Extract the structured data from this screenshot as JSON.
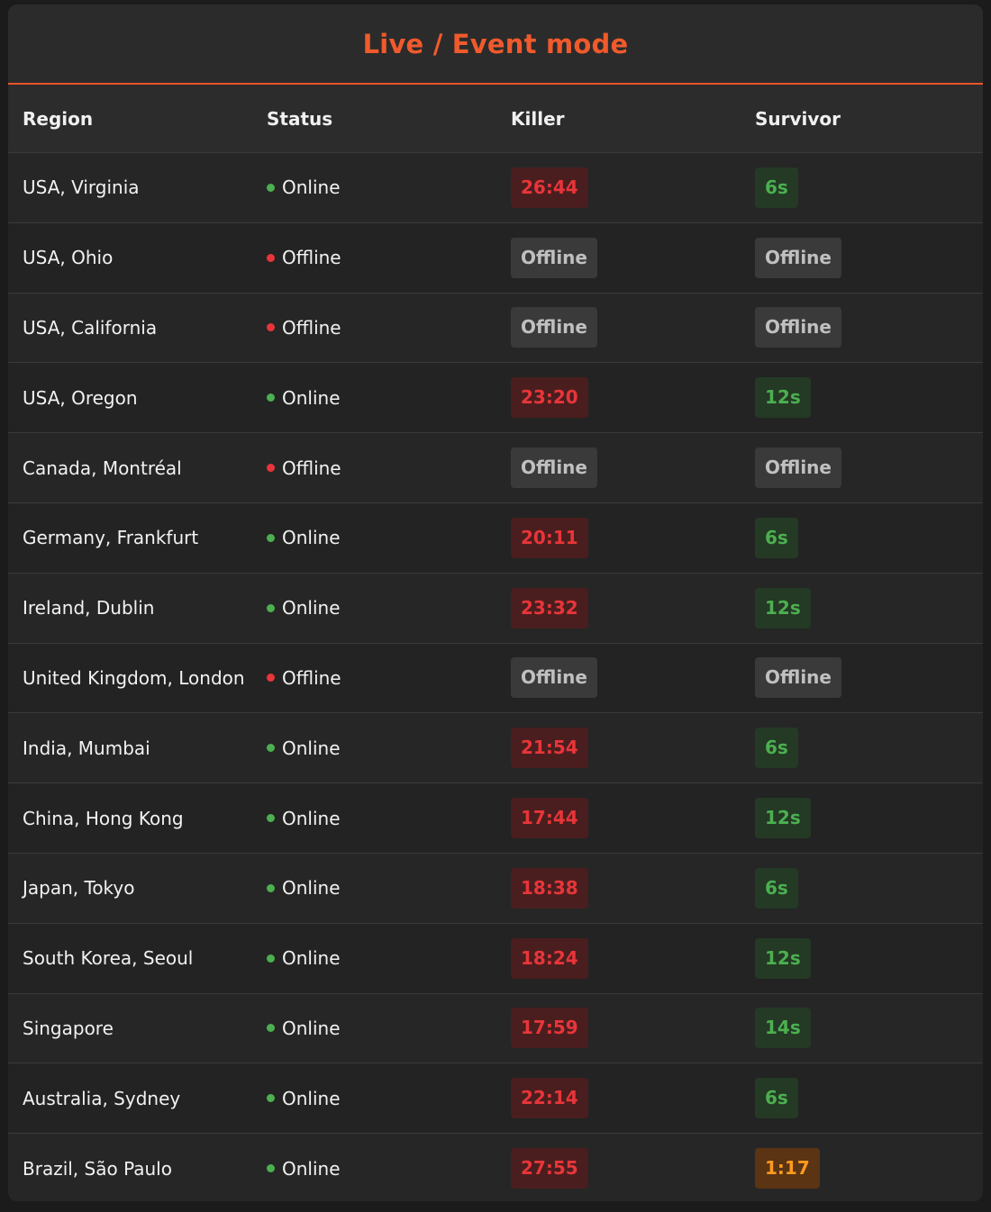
{
  "title": "Live / Event mode",
  "headers": {
    "region": "Region",
    "status": "Status",
    "killer": "Killer",
    "survivor": "Survivor"
  },
  "colors": {
    "accent": "#f05a2c",
    "online": "#4caf50",
    "offline": "#e8353a",
    "killer": "#e8353a",
    "survivor": "#4caf50",
    "survivor_slow": "#ff9a1f",
    "offline_badge": "#c0c0c0"
  },
  "rows": [
    {
      "region": "USA, Virginia",
      "status": "Online",
      "status_color": "#4caf50",
      "killer": "26:44",
      "killer_style": "red",
      "survivor": "6s",
      "survivor_style": "green"
    },
    {
      "region": "USA, Ohio",
      "status": "Offline",
      "status_color": "#e8353a",
      "killer": "Offline",
      "killer_style": "gray",
      "survivor": "Offline",
      "survivor_style": "gray"
    },
    {
      "region": "USA, California",
      "status": "Offline",
      "status_color": "#e8353a",
      "killer": "Offline",
      "killer_style": "gray",
      "survivor": "Offline",
      "survivor_style": "gray"
    },
    {
      "region": "USA, Oregon",
      "status": "Online",
      "status_color": "#4caf50",
      "killer": "23:20",
      "killer_style": "red",
      "survivor": "12s",
      "survivor_style": "green"
    },
    {
      "region": "Canada, Montréal",
      "status": "Offline",
      "status_color": "#e8353a",
      "killer": "Offline",
      "killer_style": "gray",
      "survivor": "Offline",
      "survivor_style": "gray"
    },
    {
      "region": "Germany, Frankfurt",
      "status": "Online",
      "status_color": "#4caf50",
      "killer": "20:11",
      "killer_style": "red",
      "survivor": "6s",
      "survivor_style": "green"
    },
    {
      "region": "Ireland, Dublin",
      "status": "Online",
      "status_color": "#4caf50",
      "killer": "23:32",
      "killer_style": "red",
      "survivor": "12s",
      "survivor_style": "green"
    },
    {
      "region": "United Kingdom, London",
      "status": "Offline",
      "status_color": "#e8353a",
      "killer": "Offline",
      "killer_style": "gray",
      "survivor": "Offline",
      "survivor_style": "gray"
    },
    {
      "region": "India, Mumbai",
      "status": "Online",
      "status_color": "#4caf50",
      "killer": "21:54",
      "killer_style": "red",
      "survivor": "6s",
      "survivor_style": "green"
    },
    {
      "region": "China, Hong Kong",
      "status": "Online",
      "status_color": "#4caf50",
      "killer": "17:44",
      "killer_style": "red",
      "survivor": "12s",
      "survivor_style": "green"
    },
    {
      "region": "Japan, Tokyo",
      "status": "Online",
      "status_color": "#4caf50",
      "killer": "18:38",
      "killer_style": "red",
      "survivor": "6s",
      "survivor_style": "green"
    },
    {
      "region": "South Korea, Seoul",
      "status": "Online",
      "status_color": "#4caf50",
      "killer": "18:24",
      "killer_style": "red",
      "survivor": "12s",
      "survivor_style": "green"
    },
    {
      "region": "Singapore",
      "status": "Online",
      "status_color": "#4caf50",
      "killer": "17:59",
      "killer_style": "red",
      "survivor": "14s",
      "survivor_style": "green"
    },
    {
      "region": "Australia, Sydney",
      "status": "Online",
      "status_color": "#4caf50",
      "killer": "22:14",
      "killer_style": "red",
      "survivor": "6s",
      "survivor_style": "green"
    },
    {
      "region": "Brazil, São Paulo",
      "status": "Online",
      "status_color": "#4caf50",
      "killer": "27:55",
      "killer_style": "red",
      "survivor": "1:17",
      "survivor_style": "orange"
    }
  ]
}
